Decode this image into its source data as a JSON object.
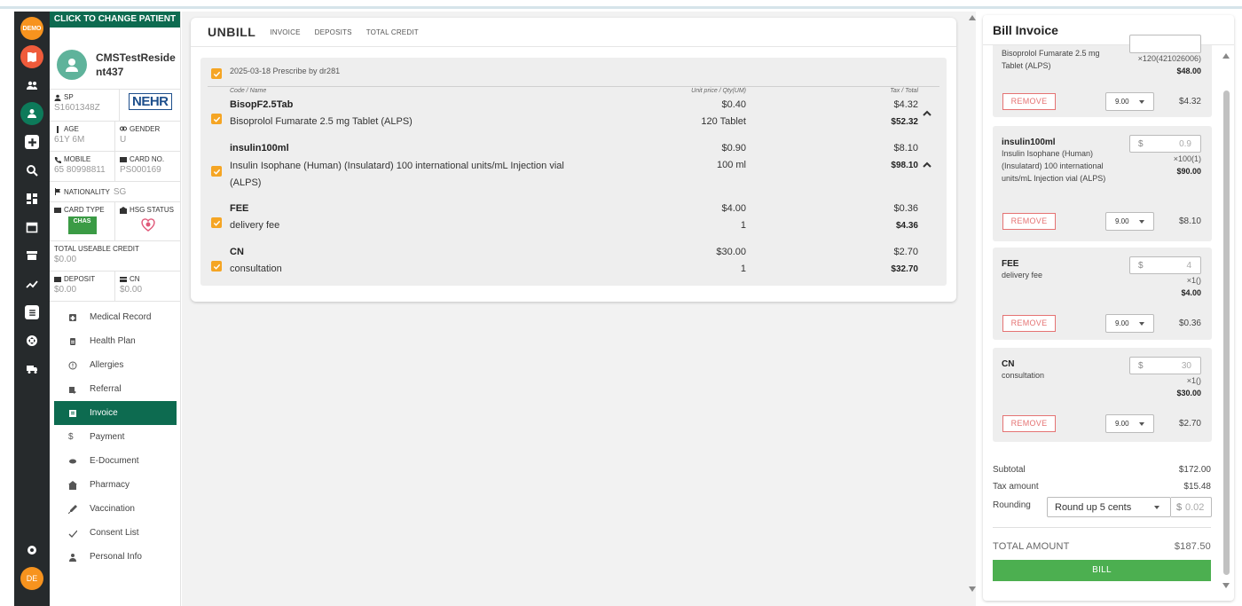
{
  "rail": {
    "demo_label": "DEMO",
    "user_initials": "DE"
  },
  "patient": {
    "header": "CLICK TO CHANGE PATIENT",
    "name": "CMSTestResident437",
    "id_type": "SP",
    "id_value": "S1601348Z",
    "nehr": "NEHR",
    "age_label": "AGE",
    "age_value": "61Y 6M",
    "gender_label": "GENDER",
    "gender_value": "U",
    "mobile_label": "MOBILE",
    "mobile_value": "65 80998811",
    "card_no_label": "CARD NO.",
    "card_no_value": "PS000169",
    "nationality_label": "NATIONALITY",
    "nationality_value": "SG",
    "card_type_label": "CARD TYPE",
    "card_type_value": "CHAS",
    "hsg_label": "HSG STATUS",
    "credit_label": "TOTAL USEABLE CREDIT",
    "credit_value": "$0.00",
    "deposit_label": "DEPOSIT",
    "deposit_value": "$0.00",
    "cn_label": "CN",
    "cn_value": "$0.00"
  },
  "nav": [
    {
      "label": "Medical Record",
      "icon": "medical-record-icon"
    },
    {
      "label": "Health Plan",
      "icon": "health-plan-icon"
    },
    {
      "label": "Allergies",
      "icon": "allergies-icon"
    },
    {
      "label": "Referral",
      "icon": "referral-icon"
    },
    {
      "label": "Invoice",
      "icon": "invoice-icon",
      "active": true
    },
    {
      "label": "Payment",
      "icon": "payment-icon"
    },
    {
      "label": "E-Document",
      "icon": "e-document-icon"
    },
    {
      "label": "Pharmacy",
      "icon": "pharmacy-icon"
    },
    {
      "label": "Vaccination",
      "icon": "vaccination-icon"
    },
    {
      "label": "Consent List",
      "icon": "consent-list-icon"
    },
    {
      "label": "Personal Info",
      "icon": "personal-info-icon"
    }
  ],
  "tabs": {
    "main": "UNBILL",
    "invoice": "INVOICE",
    "deposits": "DEPOSITS",
    "total_credit": "TOTAL CREDIT"
  },
  "unbill": {
    "prescription": "2025-03-18 Prescribe by dr281",
    "col_code": "Code / Name",
    "col_unit": "Unit price / Qty(UM)",
    "col_tax": "Tax / Total",
    "items": [
      {
        "code": "BisopF2.5Tab",
        "desc": "Bisoprolol Fumarate 2.5 mg Tablet (ALPS)",
        "unit_price": "$0.40",
        "qty": "120 Tablet",
        "tax": "$4.32",
        "total": "$52.32"
      },
      {
        "code": "insulin100ml",
        "desc": "Insulin Isophane (Human) (Insulatard) 100 international units/mL Injection vial (ALPS)",
        "unit_price": "$0.90",
        "qty": "100 ml",
        "tax": "$8.10",
        "total": "$98.10"
      },
      {
        "code": "FEE",
        "desc": "delivery fee",
        "unit_price": "$4.00",
        "qty": "1",
        "tax": "$0.36",
        "total": "$4.36"
      },
      {
        "code": "CN",
        "desc": "consultation",
        "unit_price": "$30.00",
        "qty": "1",
        "tax": "$2.70",
        "total": "$32.70"
      }
    ]
  },
  "bill": {
    "title": "Bill Invoice",
    "remove_label": "REMOVE",
    "currency": "$",
    "items": [
      {
        "desc": "Bisoprolol Fumarate 2.5 mg Tablet (ALPS)",
        "qty": "×120(421026006)",
        "total": "$48.00",
        "tax_rate": "9.00",
        "tax_amount": "$4.32"
      },
      {
        "code": "insulin100ml",
        "desc": "Insulin Isophane (Human) (Insulatard) 100 international units/mL Injection vial (ALPS)",
        "price": "0.9",
        "qty": "×100(1)",
        "total": "$90.00",
        "tax_rate": "9.00",
        "tax_amount": "$8.10"
      },
      {
        "code": "FEE",
        "desc": "delivery fee",
        "price": "4",
        "qty": "×1()",
        "total": "$4.00",
        "tax_rate": "9.00",
        "tax_amount": "$0.36"
      },
      {
        "code": "CN",
        "desc": "consultation",
        "price": "30",
        "qty": "×1()",
        "total": "$30.00",
        "tax_rate": "9.00",
        "tax_amount": "$2.70"
      }
    ],
    "subtotal_label": "Subtotal",
    "subtotal_value": "$172.00",
    "tax_label": "Tax amount",
    "tax_value": "$15.48",
    "rounding_label": "Rounding",
    "rounding_option": "Round up 5 cents",
    "rounding_value": "0.02",
    "total_label": "TOTAL AMOUNT",
    "total_value": "$187.50",
    "bill_button": "BILL"
  }
}
